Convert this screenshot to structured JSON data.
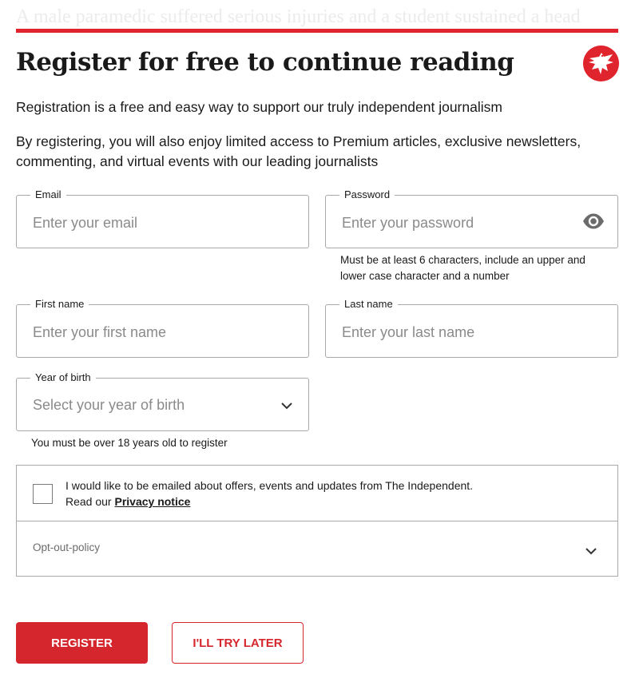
{
  "background_headline": "A male paramedic suffered serious injuries and a student sustained a head",
  "modal": {
    "title": "Register for free to continue reading",
    "intro": "Registration is a free and easy way to support our truly independent journalism",
    "intro_more": "By registering, you will also enjoy limited access to Premium articles, exclusive newsletters, commenting, and virtual events with our leading journalists"
  },
  "form": {
    "email": {
      "label": "Email",
      "placeholder": "Enter your email"
    },
    "password": {
      "label": "Password",
      "placeholder": "Enter your password",
      "hint": "Must be at least 6 characters, include an upper and lower case character and a number"
    },
    "first_name": {
      "label": "First name",
      "placeholder": "Enter your first name"
    },
    "last_name": {
      "label": "Last name",
      "placeholder": "Enter your last name"
    },
    "year_of_birth": {
      "label": "Year of birth",
      "placeholder": "Select your year of birth",
      "hint": "You must be over 18 years old to register"
    }
  },
  "consent": {
    "text": "I would like to be emailed about offers, events and updates from The Independent.",
    "read_prefix": "Read our ",
    "privacy_link": "Privacy notice",
    "opt_out_label": "Opt-out-policy"
  },
  "buttons": {
    "register": "REGISTER",
    "later": "I'LL TRY LATER"
  },
  "icons": {
    "logo": "eagle-logo-icon",
    "password_toggle": "eye-icon",
    "dropdown": "chevron-down-icon"
  },
  "colors": {
    "accent": "#e0242d",
    "border": "#a9a9a9",
    "placeholder": "#8a8a8a"
  }
}
